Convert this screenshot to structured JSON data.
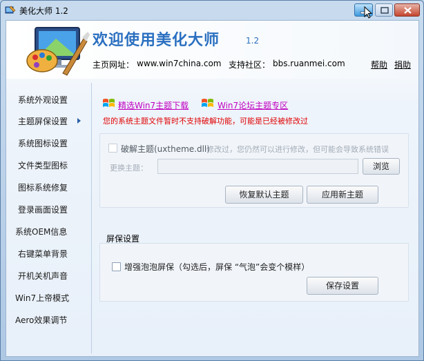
{
  "window": {
    "title": "美化大师 1.2"
  },
  "header": {
    "welcome": "欢迎使用美化大师",
    "version": "1.2",
    "homepage_label": "主页网址：",
    "homepage_url": "www.win7china.com",
    "community_label": "支持社区：",
    "community_url": "bbs.ruanmei.com",
    "help": "帮助",
    "donate": "捐助"
  },
  "sidebar": {
    "items": [
      {
        "label": "系统外观设置"
      },
      {
        "label": "主题屏保设置"
      },
      {
        "label": "系统图标设置"
      },
      {
        "label": "文件类型图标"
      },
      {
        "label": "图标系统修复"
      },
      {
        "label": "登录画面设置"
      },
      {
        "label": "系统OEM信息"
      },
      {
        "label": "右键菜单背景"
      },
      {
        "label": "开机关机声音"
      },
      {
        "label": "Win7上帝模式"
      },
      {
        "label": "Aero效果调节"
      }
    ],
    "selected_index": 1
  },
  "theme": {
    "link1": "精选Win7主题下载",
    "link2": "Win7论坛主题专区",
    "warning": "您的系统主题文件暂时不支持破解功能，可能是已经被修改过",
    "crack_checkbox": "破解主题(uxtheme.dll)",
    "crack_note": "修改过，您仍然可以进行修改，但可能会导致系统错误",
    "change_label": "更换主题：",
    "change_value": "",
    "browse": "浏览",
    "restore": "恢复默认主题",
    "apply": "应用新主题"
  },
  "screensaver": {
    "section_title": "屏保设置",
    "bubble_checkbox": "增强泡泡屏保（勾选后，屏保 “气泡”会变个模样）",
    "save": "保存设置"
  }
}
